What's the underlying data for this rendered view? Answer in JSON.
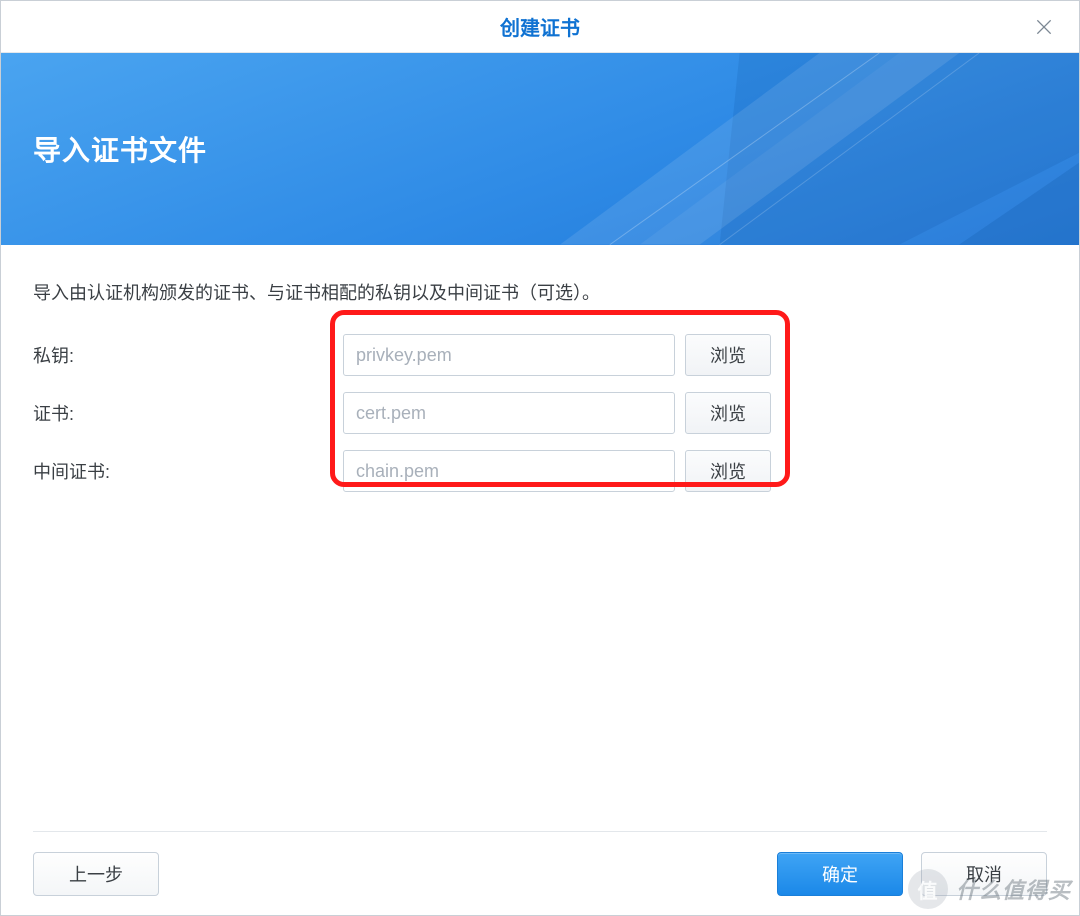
{
  "dialog": {
    "title": "创建证书"
  },
  "banner": {
    "heading": "导入证书文件"
  },
  "description": "导入由认证机构颁发的证书、与证书相配的私钥以及中间证书（可选）。",
  "form": {
    "privkey": {
      "label": "私钥:",
      "placeholder": "privkey.pem",
      "browse": "浏览"
    },
    "cert": {
      "label": "证书:",
      "placeholder": "cert.pem",
      "browse": "浏览"
    },
    "chain": {
      "label": "中间证书:",
      "placeholder": "chain.pem",
      "browse": "浏览"
    }
  },
  "footer": {
    "back": "上一步",
    "ok": "确定",
    "cancel": "取消"
  },
  "watermark": {
    "badge": "值",
    "text": "什么值得买"
  }
}
